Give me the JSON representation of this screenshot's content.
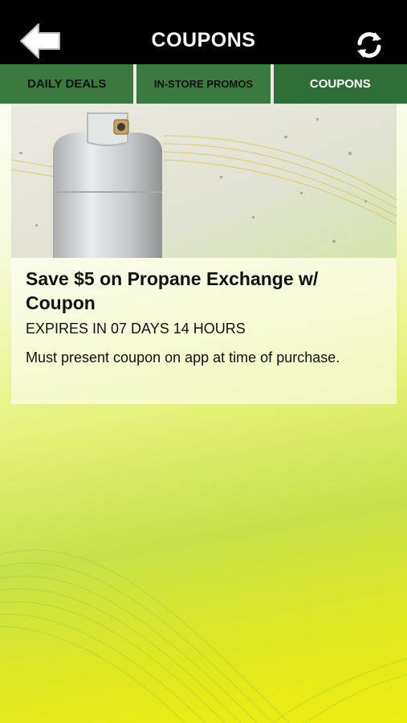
{
  "header": {
    "title": "COUPONS",
    "back_icon": "back-arrow-icon",
    "refresh_icon": "refresh-icon"
  },
  "tabs": [
    {
      "label": "DAILY DEALS"
    },
    {
      "label": "IN-STORE PROMOS"
    },
    {
      "label": "COUPONS",
      "active": true
    }
  ],
  "coupon": {
    "title": "Save $5 on Propane Exchange w/ Coupon",
    "expiry": "EXPIRES IN 07 DAYS 14 HOURS",
    "description": "Must present coupon on app at time of purchase.",
    "image": "propane-tank-image"
  },
  "colors": {
    "header_bg": "#000000",
    "tab_bg": "#3b7a3f",
    "active_tab_text": "#ffffff"
  }
}
